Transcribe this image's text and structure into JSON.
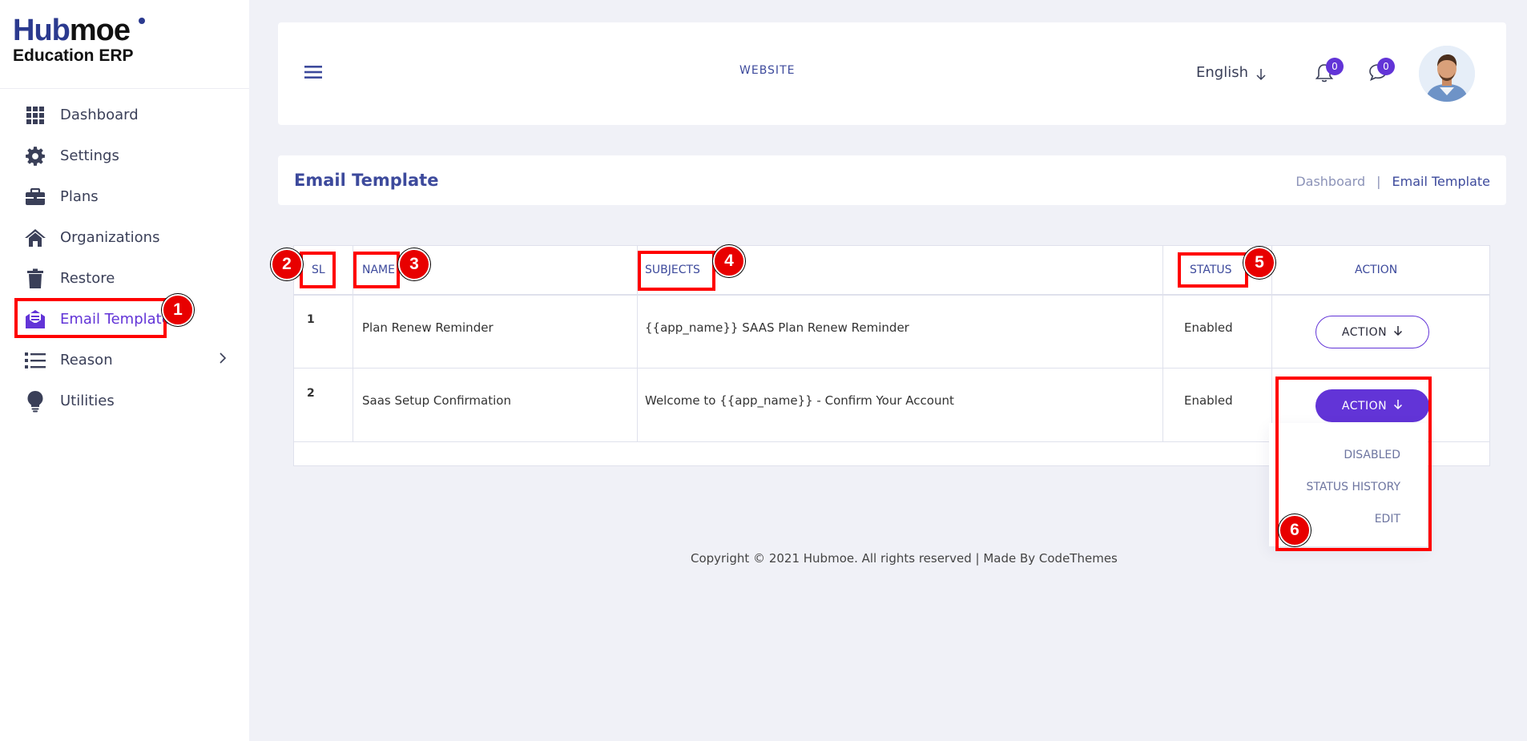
{
  "brand": {
    "part1": "Hub",
    "part2": "moe",
    "subtitle": "Education ERP"
  },
  "sidebar": {
    "items": [
      {
        "label": "Dashboard",
        "icon": "grid-icon"
      },
      {
        "label": "Settings",
        "icon": "gear-icon"
      },
      {
        "label": "Plans",
        "icon": "briefcase-icon"
      },
      {
        "label": "Organizations",
        "icon": "home-icon"
      },
      {
        "label": "Restore",
        "icon": "trash-icon"
      },
      {
        "label": "Email Template",
        "icon": "mail-open-icon",
        "active": true
      },
      {
        "label": "Reason",
        "icon": "list-icon",
        "has_submenu": true
      },
      {
        "label": "Utilities",
        "icon": "bulb-icon"
      }
    ]
  },
  "header": {
    "website_label": "WEBSITE",
    "language": "English",
    "notifications_count": "0",
    "messages_count": "0"
  },
  "page": {
    "title": "Email Template",
    "breadcrumb": {
      "home": "Dashboard",
      "separator": "|",
      "current": "Email Template"
    }
  },
  "table": {
    "headers": {
      "sl": "SL",
      "name": "NAME",
      "subjects": "SUBJECTS",
      "status": "STATUS",
      "action": "ACTION"
    },
    "rows": [
      {
        "sl": "1",
        "name": "Plan Renew Reminder",
        "subject": "{{app_name}} SAAS Plan Renew Reminder",
        "status": "Enabled",
        "action": "ACTION"
      },
      {
        "sl": "2",
        "name": "Saas Setup Confirmation",
        "subject": "Welcome to {{app_name}} - Confirm Your Account",
        "status": "Enabled",
        "action": "ACTION"
      }
    ]
  },
  "dropdown": {
    "items": [
      "DISABLED",
      "STATUS HISTORY",
      "EDIT"
    ]
  },
  "footer": {
    "text": "Copyright © 2021 Hubmoe. All rights reserved | Made By CodeThemes"
  },
  "annotations": [
    "1",
    "2",
    "3",
    "4",
    "5",
    "6"
  ],
  "colors": {
    "accent": "#6234d7",
    "primary_text": "#3d4a9c",
    "highlight": "#ff0000",
    "background": "#f0f1f7"
  }
}
